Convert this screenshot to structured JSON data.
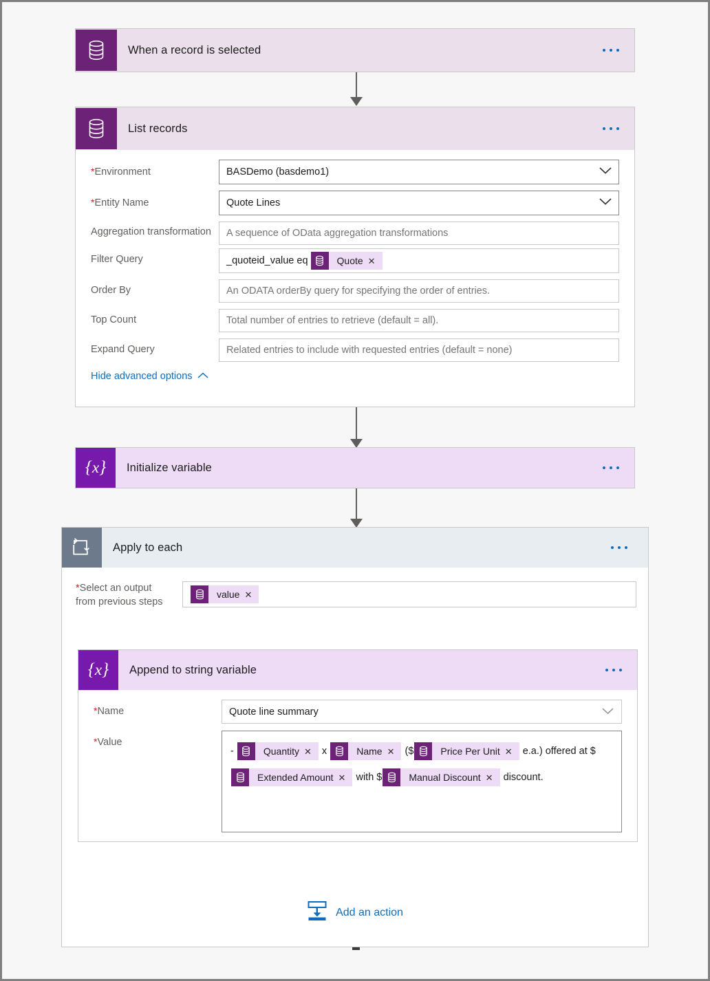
{
  "flow": {
    "colors": {
      "dataverse_icon": "#6b2277",
      "dataverse_header": "#eadfeb",
      "variable_icon": "#7719aa",
      "variable_header": "#eedcf7",
      "control_icon": "#6d7a8c",
      "control_header": "#e8edf1",
      "accent_link": "#0f6cbd",
      "required_asterisk": "#e81123",
      "canvas": "#f7f7f7"
    },
    "trigger": {
      "title": "When a record is selected",
      "icon": "dataverse-icon",
      "menu": "..."
    },
    "list_records": {
      "title": "List records",
      "icon": "dataverse-icon",
      "menu": "...",
      "fields": [
        {
          "label": "Environment",
          "required": true,
          "value": "BASDemo (basdemo1)",
          "control": "dropdown"
        },
        {
          "label": "Entity Name",
          "required": true,
          "value": "Quote Lines",
          "control": "dropdown"
        },
        {
          "label": "Aggregation transformation",
          "required": false,
          "placeholder": "A sequence of OData aggregation transformations",
          "control": "text"
        },
        {
          "label": "Filter Query",
          "required": false,
          "value": "_quoteid_value eq",
          "token": "Quote",
          "control": "token-text"
        },
        {
          "label": "Order By",
          "required": false,
          "placeholder": "An ODATA orderBy query for specifying the order of entries.",
          "control": "text"
        },
        {
          "label": "Top Count",
          "required": false,
          "placeholder": "Total number of entries to retrieve (default = all).",
          "control": "text"
        },
        {
          "label": "Expand Query",
          "required": false,
          "placeholder": "Related entries to include with requested entries (default = none)",
          "control": "text"
        }
      ],
      "advanced_link": "Hide advanced options"
    },
    "initialize_variable": {
      "title": "Initialize variable",
      "icon": "variable-icon",
      "menu": "..."
    },
    "apply_to_each": {
      "title": "Apply to each",
      "icon": "loop-icon",
      "menu": "...",
      "select_output_label_line1": "Select an output",
      "select_output_label_line2": "from previous steps",
      "select_output_token": "value"
    },
    "append_to_string": {
      "title": "Append to string variable",
      "icon": "variable-icon",
      "menu": "...",
      "name_label": "Name",
      "name_value": "Quote line summary",
      "value_label": "Value",
      "value_parts": [
        {
          "kind": "text",
          "text": "- "
        },
        {
          "kind": "token",
          "text": "Quantity"
        },
        {
          "kind": "text",
          "text": " x "
        },
        {
          "kind": "token",
          "text": "Name"
        },
        {
          "kind": "text",
          "text": " ($"
        },
        {
          "kind": "token",
          "text": "Price Per Unit"
        },
        {
          "kind": "text",
          "text": " e.a.) offered at $"
        },
        {
          "kind": "token",
          "text": "Extended Amount"
        },
        {
          "kind": "text",
          "text": " with $"
        },
        {
          "kind": "token",
          "text": "Manual Discount"
        },
        {
          "kind": "text",
          "text": " discount."
        }
      ]
    },
    "add_action": {
      "label": "Add an action",
      "icon": "add-action-icon"
    }
  }
}
